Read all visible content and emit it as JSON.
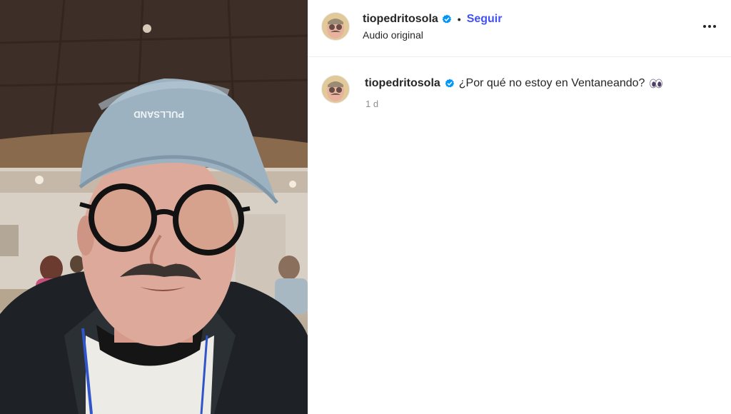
{
  "post": {
    "username": "tiopedritosola",
    "follow_label": "Seguir",
    "separator": "•",
    "audio_label": "Audio original"
  },
  "caption": {
    "username": "tiopedritosola",
    "text": "¿Por qué no estoy en Ventaneando?",
    "emoji_icon": "eyes-emoji-icon",
    "timestamp": "1 d"
  },
  "media": {
    "cap_text": "PULLSAND"
  },
  "colors": {
    "link_blue": "#4150f7",
    "verified_blue": "#0095f6",
    "muted_text": "#8e8e8e",
    "divider": "#efefef"
  }
}
